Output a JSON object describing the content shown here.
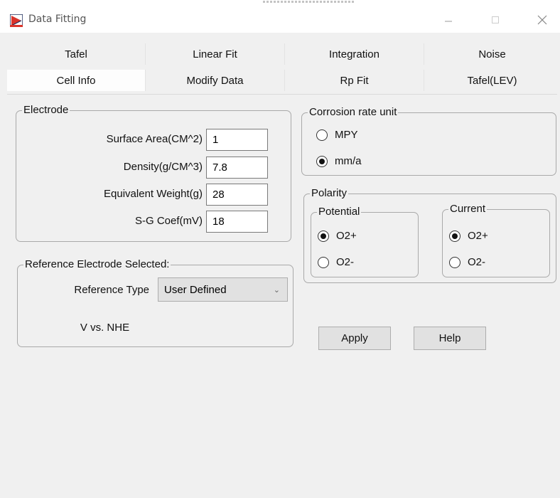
{
  "window": {
    "title": "Data Fitting"
  },
  "tabs_row1": [
    "Tafel",
    "Linear Fit",
    "Integration",
    "Noise"
  ],
  "tabs_row2": [
    "Cell Info",
    "Modify Data",
    "Rp Fit",
    "Tafel(LEV)"
  ],
  "active_tab": "Cell Info",
  "electrode": {
    "group_title": "Electrode",
    "surface_area_label": "Surface Area(CM^2)",
    "surface_area_value": "1",
    "density_label": "Density(g/CM^3)",
    "density_value": "7.8",
    "equivalent_weight_label": "Equivalent Weight(g)",
    "equivalent_weight_value": "28",
    "sg_coef_label": "S-G Coef(mV)",
    "sg_coef_value": "18"
  },
  "reference": {
    "group_title": "Reference Electrode Selected:",
    "type_label": "Reference Type",
    "type_value": "User Defined",
    "potential_text": "V vs. NHE"
  },
  "corrosion": {
    "group_title": "Corrosion rate unit",
    "options": [
      "MPY",
      "mm/a"
    ],
    "selected": "mm/a"
  },
  "polarity": {
    "group_title": "Polarity",
    "potential": {
      "title": "Potential",
      "options": [
        "O2+",
        "O2-"
      ],
      "selected": "O2+"
    },
    "current": {
      "title": "Current",
      "options": [
        "O2+",
        "O2-"
      ],
      "selected": "O2+"
    }
  },
  "buttons": {
    "apply": "Apply",
    "help": "Help"
  },
  "colors": {
    "dialog_bg": "#f0f0f0",
    "titlebar_bg": "#ffffff",
    "button_bg": "#e1e1e1",
    "group_border": "#a9a9a9"
  },
  "icons": {
    "app": "data-fitting-app-icon",
    "minimize": "minimize-icon",
    "maximize": "maximize-icon",
    "close": "close-icon",
    "dropdown": "chevron-down-icon"
  }
}
